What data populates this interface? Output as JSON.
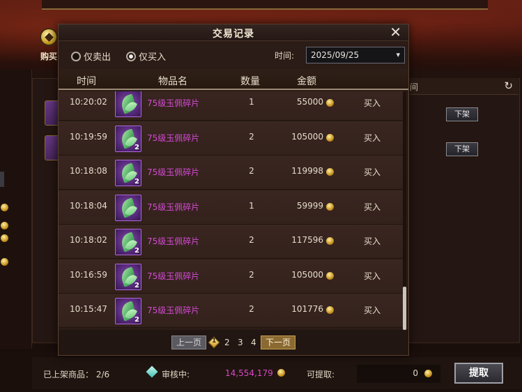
{
  "background": {
    "title": "",
    "buy_tab_label": "购买",
    "right_header": "间",
    "unlist_button_label": "下架",
    "listed": {
      "label": "已上架商品：",
      "value": "2/6"
    },
    "review": {
      "label": "审核中:",
      "value": "14,554,179"
    },
    "withdrawable": {
      "label": "可提取:",
      "value": "0"
    },
    "withdraw_button_label": "提取"
  },
  "modal": {
    "title": "交易记录",
    "filters": {
      "sell_only": "仅卖出",
      "buy_only": "仅买入",
      "selected": "buy_only"
    },
    "time_label": "时间:",
    "date_value": "2025/09/25",
    "columns": {
      "time": "时间",
      "item": "物品名",
      "qty": "数量",
      "amount": "金额"
    },
    "rows": [
      {
        "time": "10:20:02",
        "item": "75级玉佩碎片",
        "stack": "",
        "qty": "1",
        "amount": "55000",
        "type": "买入"
      },
      {
        "time": "10:19:59",
        "item": "75级玉佩碎片",
        "stack": "2",
        "qty": "2",
        "amount": "105000",
        "type": "买入"
      },
      {
        "time": "10:18:08",
        "item": "75级玉佩碎片",
        "stack": "2",
        "qty": "2",
        "amount": "119998",
        "type": "买入"
      },
      {
        "time": "10:18:04",
        "item": "75级玉佩碎片",
        "stack": "",
        "qty": "1",
        "amount": "59999",
        "type": "买入"
      },
      {
        "time": "10:18:02",
        "item": "75级玉佩碎片",
        "stack": "2",
        "qty": "2",
        "amount": "117596",
        "type": "买入"
      },
      {
        "time": "10:16:59",
        "item": "75级玉佩碎片",
        "stack": "2",
        "qty": "2",
        "amount": "105000",
        "type": "买入"
      },
      {
        "time": "10:15:47",
        "item": "75级玉佩碎片",
        "stack": "2",
        "qty": "2",
        "amount": "101776",
        "type": "买入"
      }
    ],
    "scroll": {
      "thumb_start": 0.82,
      "thumb_size": 0.18
    },
    "pager": {
      "prev": "上一页",
      "current": "1",
      "pages": [
        "2",
        "3",
        "4"
      ],
      "next": "下一页"
    }
  },
  "colors": {
    "item_name": "#d44ad4",
    "review_value": "#d848c8",
    "coin": "#c89320"
  },
  "icons": {
    "close": "close-icon",
    "refresh": "refresh-icon",
    "coin": "gold-coin-icon",
    "item": "jade-fragment-icon"
  }
}
